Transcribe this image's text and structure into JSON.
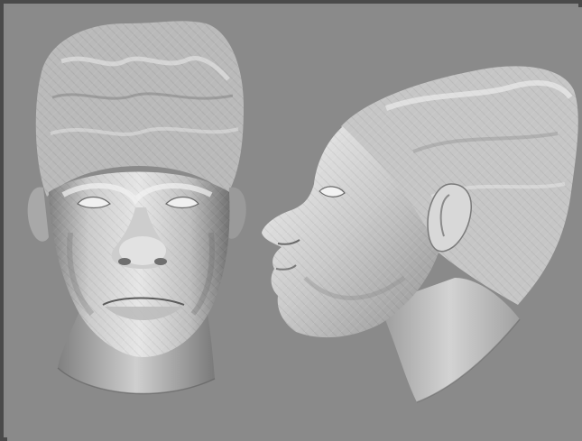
{
  "viewport": {
    "background": "#8a8a8a",
    "border": "#4a4a4a",
    "content": [
      "front-view-head-model",
      "side-view-head-model"
    ]
  },
  "colors": {
    "mesh_light": "#e6e6e6",
    "mesh_mid": "#bdbdbd",
    "mesh_dark": "#6e6e6e"
  }
}
